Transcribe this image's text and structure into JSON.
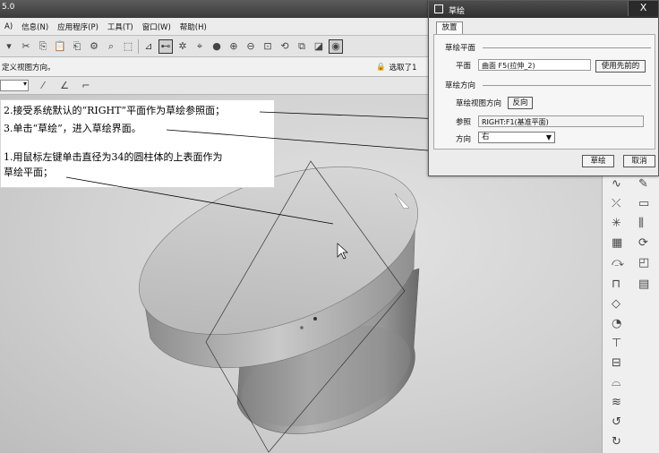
{
  "window": {
    "title": "5.0"
  },
  "menu": [
    "A)",
    "信息(N)",
    "应用程序(P)",
    "工具(T)",
    "窗口(W)",
    "帮助(H)"
  ],
  "status": {
    "text": "定义视图方向。",
    "filter_label": "选取了1"
  },
  "annotations": {
    "step1": "1.用鼠标左键单击直径为34的圆柱体的上表面作为",
    "step1b": "草绘平面；",
    "step2": "2.接受系统默认的“RIGHT”平面作为草绘参照面；",
    "step3": "3.单击“草绘”，进入草绘界面。"
  },
  "dialog": {
    "title": "草绘",
    "close": "X",
    "tab": "放置",
    "group_plane": "草绘平面",
    "plane_label": "平面",
    "plane_value": "曲面 F5(拉伸_2)",
    "use_previous": "使用先前的",
    "group_orient": "草绘方向",
    "view_direction_label": "草绘视图方向",
    "flip": "反向",
    "reference_label": "参照",
    "reference_value": "RIGHT:F1(基准平面)",
    "direction_label": "方向",
    "direction_value": "右",
    "sketch_button": "草绘",
    "cancel_button": "取消"
  }
}
